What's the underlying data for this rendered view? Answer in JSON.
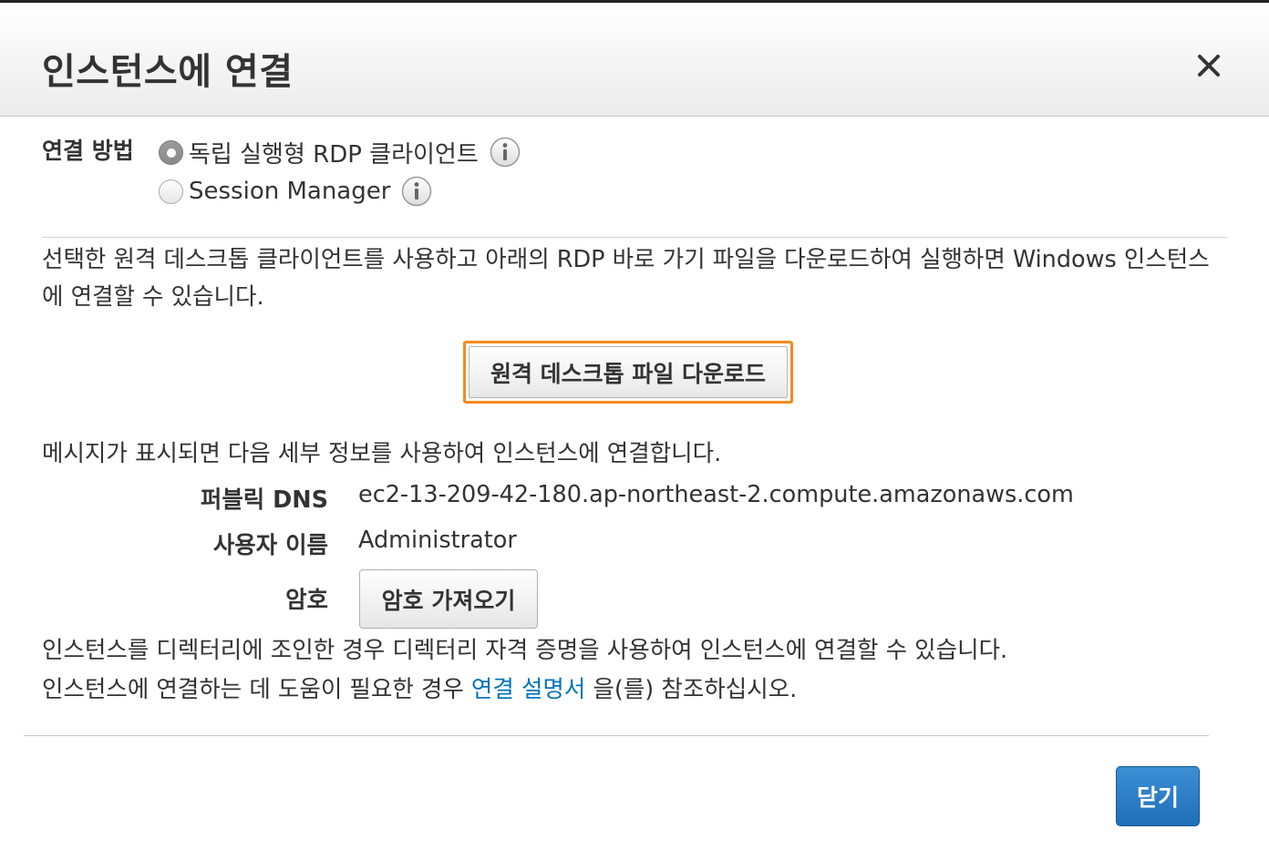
{
  "dialog": {
    "title": "인스턴스에 연결",
    "close_icon": "close-icon"
  },
  "connection_method": {
    "label": "연결 방법",
    "options": [
      {
        "label": "독립 실행형 RDP 클라이언트",
        "selected": true,
        "icon": "info-icon"
      },
      {
        "label": "Session Manager",
        "selected": false,
        "icon": "info-icon"
      }
    ]
  },
  "description": "선택한 원격 데스크톱 클라이언트를 사용하고 아래의 RDP 바로 가기 파일을 다운로드하여 실행하면 Windows 인스턴스에 연결할 수 있습니다.",
  "download_button": "원격 데스크톱 파일 다운로드",
  "details_message": "메시지가 표시되면 다음 세부 정보를 사용하여 인스턴스에 연결합니다.",
  "details": {
    "dns_label": "퍼블릭 DNS",
    "dns_value": "ec2-13-209-42-180.ap-northeast-2.compute.amazonaws.com",
    "user_label": "사용자 이름",
    "user_value": "Administrator",
    "password_label": "암호",
    "password_button": "암호 가져오기"
  },
  "notes": {
    "domain_join": "인스턴스를 디렉터리에 조인한 경우 디렉터리 자격 증명을 사용하여 인스턴스에 연결할 수 있습니다.",
    "help_prefix": "인스턴스에 연결하는 데 도움이 필요한 경우 ",
    "help_link": "연결 설명서",
    "help_suffix": " 을(를) 참조하십시오."
  },
  "footer": {
    "close_button": "닫기"
  },
  "colors": {
    "accent_orange": "#f28b1e",
    "primary_blue": "#1f6fb9",
    "link_blue": "#0073bb"
  }
}
